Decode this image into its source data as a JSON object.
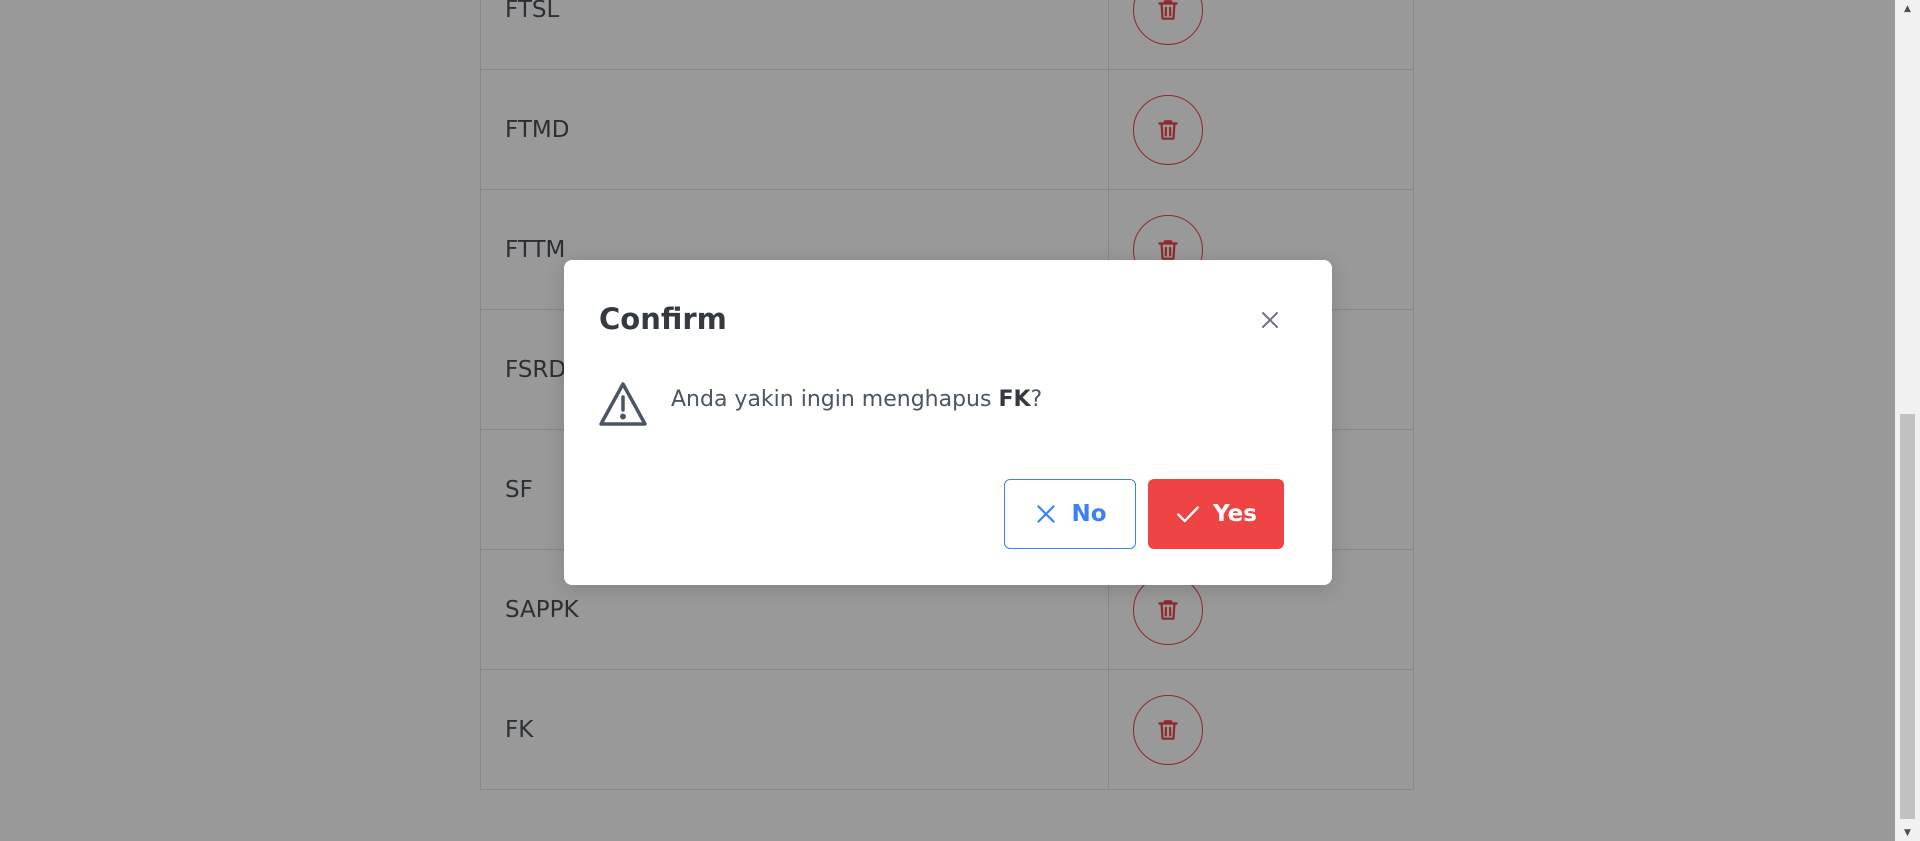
{
  "table": {
    "rows": [
      {
        "name": "FTSL"
      },
      {
        "name": "FTMD"
      },
      {
        "name": "FTTM"
      },
      {
        "name": "FSRD"
      },
      {
        "name": "SF"
      },
      {
        "name": "SAPPK"
      },
      {
        "name": "FK"
      }
    ]
  },
  "dialog": {
    "title": "Confirm",
    "message_prefix": "Anda yakin ingin menghapus ",
    "message_target": "FK",
    "message_suffix": "?",
    "no_label": "No",
    "yes_label": "Yes"
  },
  "icons": {
    "row_action": "trash-icon",
    "close": "close-icon",
    "warning": "warning-triangle-icon",
    "no": "x-icon",
    "yes": "check-icon"
  },
  "colors": {
    "danger": "#ef4444",
    "primary": "#3b82f6",
    "overlay": "rgba(0,0,0,0.4)"
  }
}
